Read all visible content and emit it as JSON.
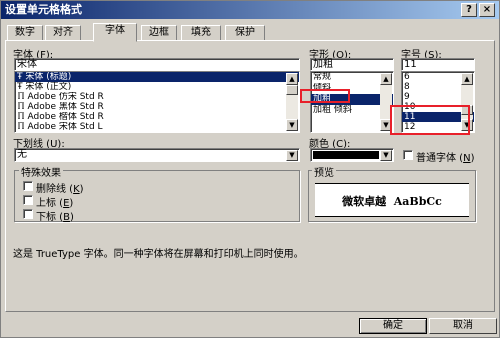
{
  "window": {
    "title": "设置单元格格式",
    "help_button": "?",
    "close_button": "×"
  },
  "tabs": [
    "数字",
    "对齐",
    "字体",
    "边框",
    "填充",
    "保护"
  ],
  "font": {
    "label_text": "字体",
    "label_key": "F",
    "value": "宋体",
    "items": [
      {
        "glyph": "Ŧ",
        "text": "宋体 (标题)"
      },
      {
        "glyph": "Ŧ",
        "text": "宋体 (正文)"
      },
      {
        "glyph": "ℿ",
        "text": "Adobe 仿宋 Std R"
      },
      {
        "glyph": "ℿ",
        "text": "Adobe 黑体 Std R"
      },
      {
        "glyph": "ℿ",
        "text": "Adobe 楷体 Std R"
      },
      {
        "glyph": "ℿ",
        "text": "Adobe 宋体 Std L"
      }
    ]
  },
  "style": {
    "label_text": "字形",
    "label_key": "O",
    "value": "加粗",
    "items": [
      "常规",
      "倾斜",
      "加粗",
      "加粗 倾斜"
    ]
  },
  "size": {
    "label_text": "字号",
    "label_key": "S",
    "value": "11",
    "items": [
      "6",
      "8",
      "9",
      "10",
      "11",
      "12"
    ]
  },
  "underline": {
    "label_text": "下划线",
    "label_key": "U",
    "value": "无"
  },
  "color": {
    "label_text": "颜色",
    "label_key": "C",
    "swatch": "#000000"
  },
  "normal_font": {
    "label_text": "普通字体",
    "label_key": "N"
  },
  "effects": {
    "title": "特殊效果",
    "items": [
      {
        "text": "删除线",
        "key": "K"
      },
      {
        "text": "上标",
        "key": "E"
      },
      {
        "text": "下标",
        "key": "B"
      }
    ]
  },
  "preview": {
    "label": "预览",
    "text": "微软卓越  AaBbCc"
  },
  "info_text": "这是 TrueType 字体。同一种字体将在屏幕和打印机上同时使用。",
  "buttons": {
    "ok": "确定",
    "cancel": "取消"
  }
}
